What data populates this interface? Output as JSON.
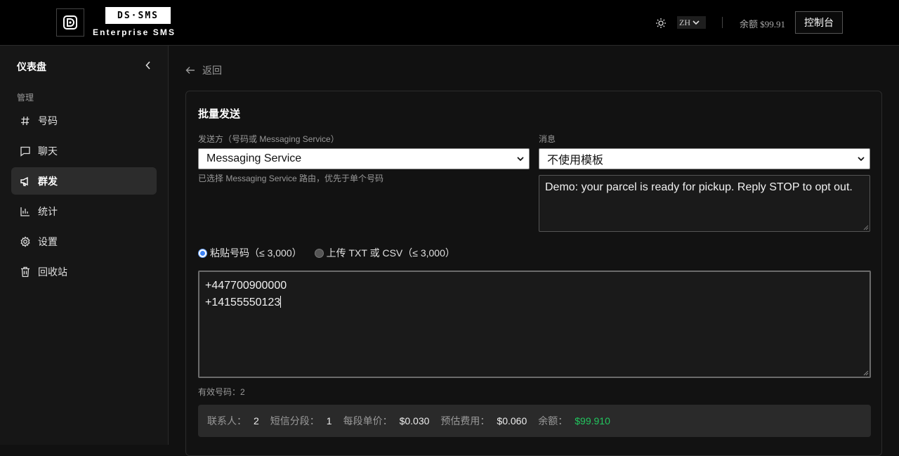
{
  "header": {
    "brand_badge": "DS·SMS",
    "brand_sub": "Enterprise SMS",
    "lang": "ZH",
    "balance": "余额 $99.91",
    "console_label": "控制台"
  },
  "sidebar": {
    "title": "仪表盘",
    "section": "管理",
    "items": [
      {
        "label": "号码",
        "icon": "hash-icon"
      },
      {
        "label": "聊天",
        "icon": "chat-icon"
      },
      {
        "label": "群发",
        "icon": "megaphone-icon",
        "active": true
      },
      {
        "label": "统计",
        "icon": "bar-chart-icon"
      },
      {
        "label": "设置",
        "icon": "gear-icon"
      },
      {
        "label": "回收站",
        "icon": "trash-icon"
      }
    ]
  },
  "main": {
    "back_label": "返回",
    "title": "批量发送",
    "sender_label": "发送方（号码或 Messaging Service）",
    "sender_value": "Messaging Service",
    "sender_hint": "已选择 Messaging Service 路由，优先于单个号码",
    "message_label": "消息",
    "template_value": "不使用模板",
    "message_text": "Demo: your parcel is ready for pickup. Reply STOP to opt out.",
    "radio_paste": "粘贴号码（≤ 3,000）",
    "radio_upload": "上传 TXT 或 CSV（≤ 3,000）",
    "numbers": [
      "+447700900000",
      "+14155550123"
    ],
    "valid_count": "有效号码：2",
    "summary": {
      "contacts_label": "联系人：",
      "contacts_value": "2",
      "segments_label": "短信分段：",
      "segments_value": "1",
      "unit_price_label": "每段单价：",
      "unit_price_value": "$0.030",
      "est_cost_label": "预估费用：",
      "est_cost_value": "$0.060",
      "balance_label": "余额：",
      "balance_value": "$99.910"
    }
  },
  "colors": {
    "accent_green": "#22c55e",
    "radio_blue": "#3b82f6"
  }
}
